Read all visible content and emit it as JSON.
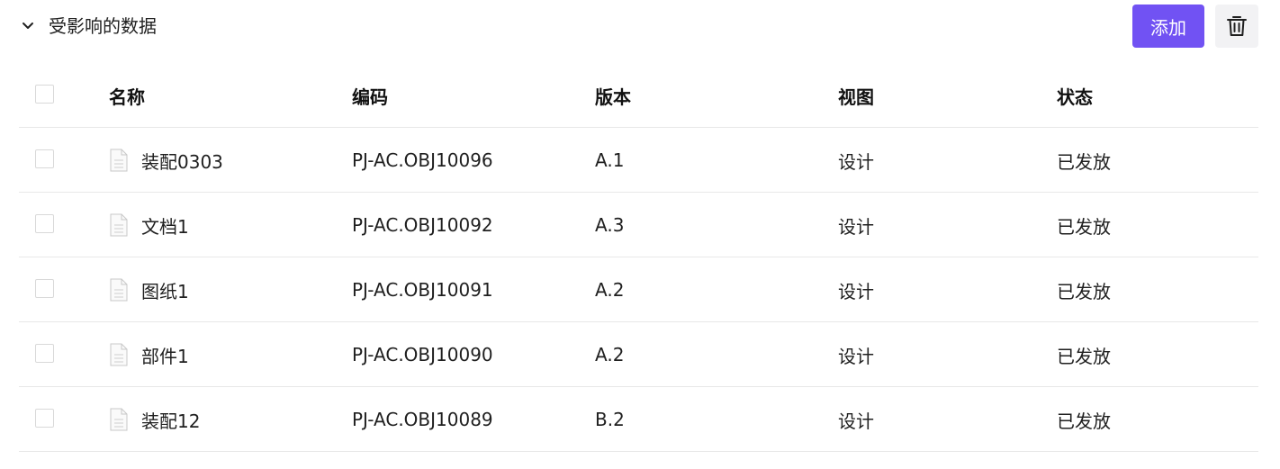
{
  "header": {
    "title": "受影响的数据",
    "collapse_icon": "chevron-down-icon",
    "add_label": "添加",
    "delete_icon": "trash-icon",
    "accent_color": "#7152f3"
  },
  "table": {
    "columns": {
      "name": "名称",
      "code": "编码",
      "version": "版本",
      "view": "视图",
      "status": "状态"
    },
    "rows": [
      {
        "name": "装配0303",
        "code": "PJ-AC.OBJ10096",
        "version": "A.1",
        "view": "设计",
        "status": "已发放",
        "icon": "document-icon"
      },
      {
        "name": "文档1",
        "code": "PJ-AC.OBJ10092",
        "version": "A.3",
        "view": "设计",
        "status": "已发放",
        "icon": "document-icon"
      },
      {
        "name": "图纸1",
        "code": "PJ-AC.OBJ10091",
        "version": "A.2",
        "view": "设计",
        "status": "已发放",
        "icon": "document-icon"
      },
      {
        "name": "部件1",
        "code": "PJ-AC.OBJ10090",
        "version": "A.2",
        "view": "设计",
        "status": "已发放",
        "icon": "document-icon"
      },
      {
        "name": "装配12",
        "code": "PJ-AC.OBJ10089",
        "version": "B.2",
        "view": "设计",
        "status": "已发放",
        "icon": "document-icon"
      }
    ]
  }
}
